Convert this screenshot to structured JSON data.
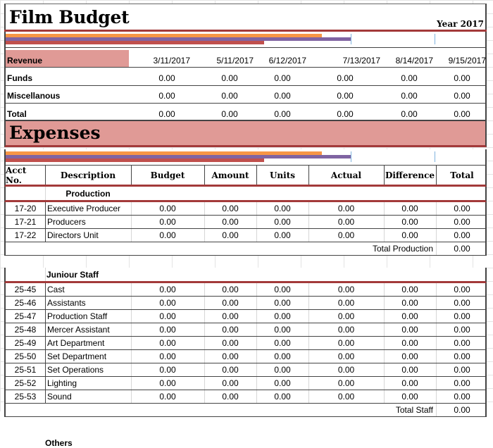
{
  "title": "Film Budget",
  "year_label": "Year 2017",
  "colors": {
    "accent_red": "#a33a3a",
    "header_fill": "#e09a96",
    "bar_orange": "#f79646",
    "bar_purple": "#8064a2",
    "bar_red": "#c0504d",
    "tick_blue": "#7fb3de"
  },
  "progress_bars": {
    "revenue": {
      "orange": 0.66,
      "purple": 0.72,
      "red": 0.54
    },
    "expenses": {
      "orange": 0.66,
      "purple": 0.72,
      "red": 0.54
    }
  },
  "revenue": {
    "header_label": "Revenue",
    "dates": [
      "3/11/2017",
      "5/11/2017",
      "6/12/2017",
      "7/13/2017",
      "8/14/2017",
      "9/15/2017"
    ],
    "rows": [
      {
        "label": "Funds",
        "values": [
          "0.00",
          "0.00",
          "0.00",
          "0.00",
          "0.00",
          "0.00"
        ]
      },
      {
        "label": "Miscellanous",
        "values": [
          "0.00",
          "0.00",
          "0.00",
          "0.00",
          "0.00",
          "0.00"
        ]
      },
      {
        "label": "Total",
        "values": [
          "0.00",
          "0.00",
          "0.00",
          "0.00",
          "0.00",
          "0.00"
        ]
      }
    ]
  },
  "expenses": {
    "title": "Expenses",
    "columns": [
      "Acct No.",
      "Description",
      "Budget",
      "Amount",
      "Units",
      "Actual",
      "Difference",
      "Total"
    ],
    "sections": [
      {
        "name": "Production",
        "rows": [
          {
            "acct": "17-20",
            "desc": "Executive Producer",
            "budget": "0.00",
            "amount": "0.00",
            "units": "0.00",
            "actual": "0.00",
            "difference": "0.00",
            "total": "0.00"
          },
          {
            "acct": "17-21",
            "desc": "Producers",
            "budget": "0.00",
            "amount": "0.00",
            "units": "0.00",
            "actual": "0.00",
            "difference": "0.00",
            "total": "0.00"
          },
          {
            "acct": "17-22",
            "desc": "Directors Unit",
            "budget": "0.00",
            "amount": "0.00",
            "units": "0.00",
            "actual": "0.00",
            "difference": "0.00",
            "total": "0.00"
          }
        ],
        "total_label": "Total Production",
        "total_value": "0.00"
      },
      {
        "name": "Juniour Staff",
        "rows": [
          {
            "acct": "25-45",
            "desc": "Cast",
            "budget": "0.00",
            "amount": "0.00",
            "units": "0.00",
            "actual": "0.00",
            "difference": "0.00",
            "total": "0.00"
          },
          {
            "acct": "25-46",
            "desc": "Assistants",
            "budget": "0.00",
            "amount": "0.00",
            "units": "0.00",
            "actual": "0.00",
            "difference": "0.00",
            "total": "0.00"
          },
          {
            "acct": "25-47",
            "desc": "Production Staff",
            "budget": "0.00",
            "amount": "0.00",
            "units": "0.00",
            "actual": "0.00",
            "difference": "0.00",
            "total": "0.00"
          },
          {
            "acct": "25-48",
            "desc": "Mercer Assistant",
            "budget": "0.00",
            "amount": "0.00",
            "units": "0.00",
            "actual": "0.00",
            "difference": "0.00",
            "total": "0.00"
          },
          {
            "acct": "25-49",
            "desc": "Art Department",
            "budget": "0.00",
            "amount": "0.00",
            "units": "0.00",
            "actual": "0.00",
            "difference": "0.00",
            "total": "0.00"
          },
          {
            "acct": "25-50",
            "desc": "Set Department",
            "budget": "0.00",
            "amount": "0.00",
            "units": "0.00",
            "actual": "0.00",
            "difference": "0.00",
            "total": "0.00"
          },
          {
            "acct": "25-51",
            "desc": "Set Operations",
            "budget": "0.00",
            "amount": "0.00",
            "units": "0.00",
            "actual": "0.00",
            "difference": "0.00",
            "total": "0.00"
          },
          {
            "acct": "25-52",
            "desc": "Lighting",
            "budget": "0.00",
            "amount": "0.00",
            "units": "0.00",
            "actual": "0.00",
            "difference": "0.00",
            "total": "0.00"
          },
          {
            "acct": "25-53",
            "desc": "Sound",
            "budget": "0.00",
            "amount": "0.00",
            "units": "0.00",
            "actual": "0.00",
            "difference": "0.00",
            "total": "0.00"
          }
        ],
        "total_label": "Total Staff",
        "total_value": "0.00"
      },
      {
        "name": "Others",
        "rows": []
      }
    ]
  }
}
